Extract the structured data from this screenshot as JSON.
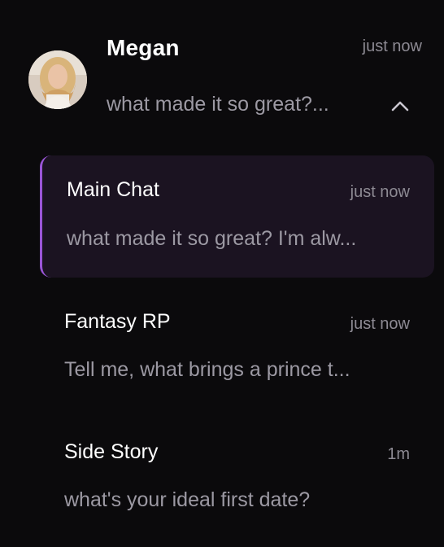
{
  "contact": {
    "name": "Megan",
    "time": "just now",
    "preview": "what made it so great?...",
    "collapse_icon": "chevron-up-icon"
  },
  "chats": [
    {
      "title": "Main Chat",
      "time": "just now",
      "preview": "what made it so great? I'm alw...",
      "active": true
    },
    {
      "title": "Fantasy RP",
      "time": "just now",
      "preview": "Tell me, what brings a prince t...",
      "active": false
    },
    {
      "title": "Side Story",
      "time": "1m",
      "preview": "what's your ideal first date?",
      "active": false
    }
  ],
  "colors": {
    "background": "#0b0a0c",
    "active_bg": "#1b1321",
    "accent": "#9a55d6",
    "primary_text": "#ffffff",
    "secondary_text": "#9c99a3"
  }
}
